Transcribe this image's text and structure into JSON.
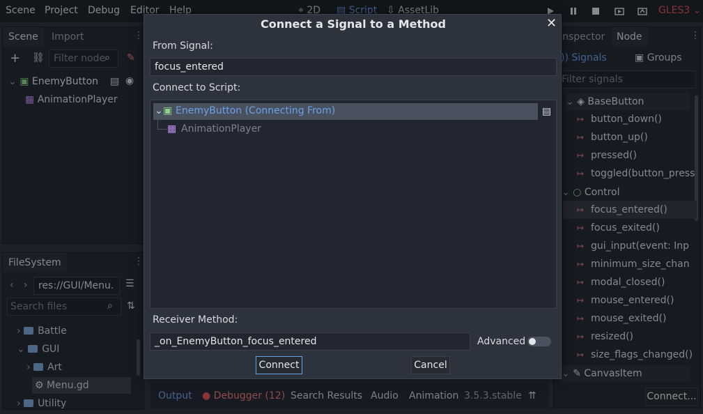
{
  "menu": {
    "items": [
      "Scene",
      "Project",
      "Debug",
      "Editor",
      "Help"
    ],
    "modes": [
      "2D",
      "Script",
      "AssetLib"
    ],
    "renderer": "GLES3"
  },
  "scene_panel": {
    "tabs": [
      "Scene",
      "Import"
    ],
    "filter_placeholder": "Filter node",
    "nodes": [
      "EnemyButton",
      "AnimationPlayer"
    ]
  },
  "filesystem_panel": {
    "tab": "FileSystem",
    "path": "res://GUI/Menu.",
    "search_placeholder": "Search files",
    "items": [
      "Battle",
      "GUI",
      "Art",
      "Menu.gd",
      "Utility"
    ]
  },
  "node_panel": {
    "tabs": [
      "Inspector",
      "Node"
    ],
    "subtabs": [
      "Signals",
      "Groups"
    ],
    "filter_placeholder": "Filter signals",
    "sections": {
      "basebutton": "BaseButton",
      "control": "Control",
      "canvasitem": "CanvasItem"
    },
    "basebutton_signals": [
      "button_down()",
      "button_up()",
      "pressed()",
      "toggled(button_press"
    ],
    "control_signals": [
      "focus_entered()",
      "focus_exited()",
      "gui_input(event: Inp",
      "minimum_size_chan",
      "modal_closed()",
      "mouse_entered()",
      "mouse_exited()",
      "resized()",
      "size_flags_changed()"
    ],
    "connect_label": "Connect..."
  },
  "dialog": {
    "title": "Connect a Signal to a Method",
    "from_signal_label": "From Signal:",
    "from_signal_value": "focus_entered",
    "connect_to_script_label": "Connect to Script:",
    "tree": {
      "selected": "EnemyButton (Connecting From)",
      "child": "AnimationPlayer"
    },
    "receiver_method_label": "Receiver Method:",
    "receiver_method_value": "_on_EnemyButton_focus_entered",
    "advanced_label": "Advanced",
    "connect_button": "Connect",
    "cancel_button": "Cancel"
  },
  "bottom_bar": {
    "tabs": [
      "Output",
      "Debugger (12)",
      "Search Results",
      "Audio",
      "Animation"
    ],
    "version": "3.5.3.stable"
  },
  "colors": {
    "accent": "#6aa0e8",
    "signal_arrow": "#e57b7b",
    "control_circle": "#8fd18a",
    "animation_icon": "#c38ef1",
    "error_dot": "#e0525c"
  }
}
